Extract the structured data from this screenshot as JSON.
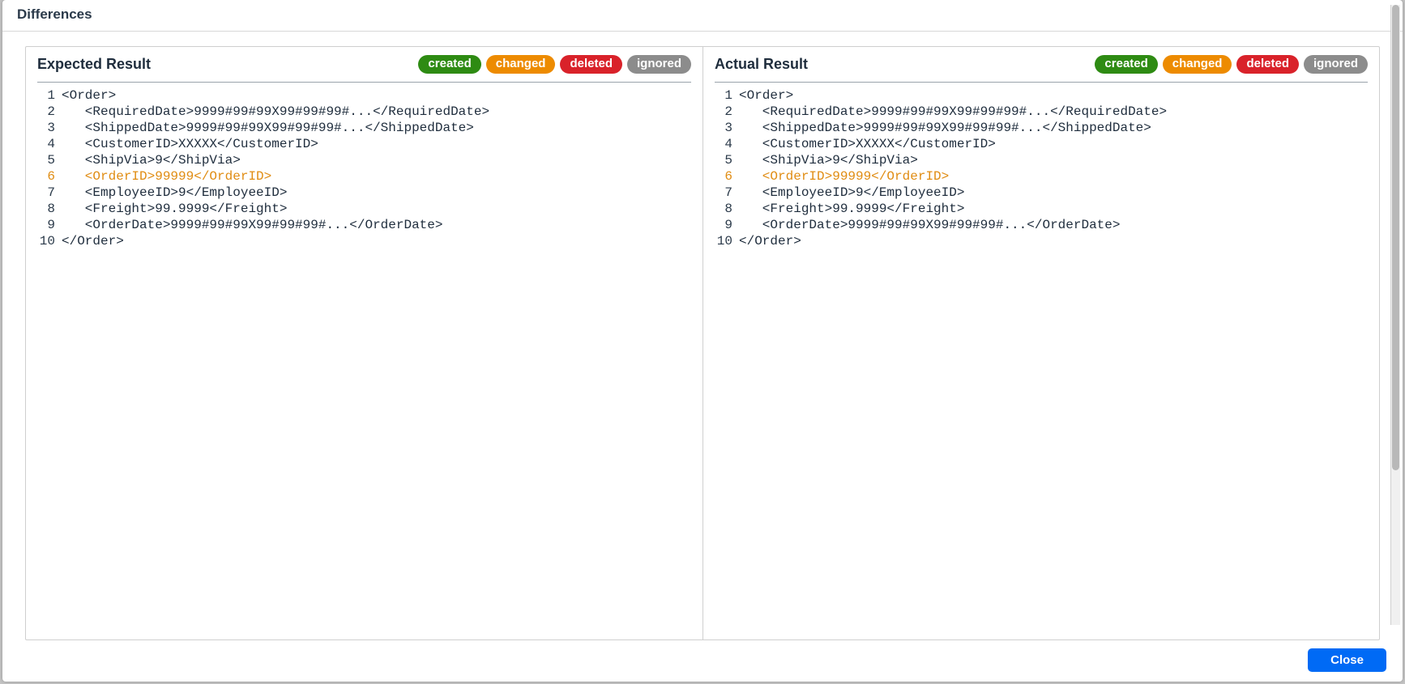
{
  "dialog": {
    "title": "Differences",
    "close_label": "Close"
  },
  "badges": {
    "created": "created",
    "changed": "changed",
    "deleted": "deleted",
    "ignored": "ignored"
  },
  "panes": [
    {
      "title": "Expected Result",
      "lines": [
        {
          "n": 1,
          "indent": 0,
          "text": "<Order>",
          "state": ""
        },
        {
          "n": 2,
          "indent": 1,
          "text": "<RequiredDate>9999#99#99X99#99#99#...</RequiredDate>",
          "state": ""
        },
        {
          "n": 3,
          "indent": 1,
          "text": "<ShippedDate>9999#99#99X99#99#99#...</ShippedDate>",
          "state": ""
        },
        {
          "n": 4,
          "indent": 1,
          "text": "<CustomerID>XXXXX</CustomerID>",
          "state": ""
        },
        {
          "n": 5,
          "indent": 1,
          "text": "<ShipVia>9</ShipVia>",
          "state": ""
        },
        {
          "n": 6,
          "indent": 1,
          "text": "<OrderID>99999</OrderID>",
          "state": "changed"
        },
        {
          "n": 7,
          "indent": 1,
          "text": "<EmployeeID>9</EmployeeID>",
          "state": ""
        },
        {
          "n": 8,
          "indent": 1,
          "text": "<Freight>99.9999</Freight>",
          "state": ""
        },
        {
          "n": 9,
          "indent": 1,
          "text": "<OrderDate>9999#99#99X99#99#99#...</OrderDate>",
          "state": ""
        },
        {
          "n": 10,
          "indent": 0,
          "text": "</Order>",
          "state": ""
        }
      ]
    },
    {
      "title": "Actual Result",
      "lines": [
        {
          "n": 1,
          "indent": 0,
          "text": "<Order>",
          "state": ""
        },
        {
          "n": 2,
          "indent": 1,
          "text": "<RequiredDate>9999#99#99X99#99#99#...</RequiredDate>",
          "state": ""
        },
        {
          "n": 3,
          "indent": 1,
          "text": "<ShippedDate>9999#99#99X99#99#99#...</ShippedDate>",
          "state": ""
        },
        {
          "n": 4,
          "indent": 1,
          "text": "<CustomerID>XXXXX</CustomerID>",
          "state": ""
        },
        {
          "n": 5,
          "indent": 1,
          "text": "<ShipVia>9</ShipVia>",
          "state": ""
        },
        {
          "n": 6,
          "indent": 1,
          "text": "<OrderID>99999</OrderID>",
          "state": "changed"
        },
        {
          "n": 7,
          "indent": 1,
          "text": "<EmployeeID>9</EmployeeID>",
          "state": ""
        },
        {
          "n": 8,
          "indent": 1,
          "text": "<Freight>99.9999</Freight>",
          "state": ""
        },
        {
          "n": 9,
          "indent": 1,
          "text": "<OrderDate>9999#99#99X99#99#99#...</OrderDate>",
          "state": ""
        },
        {
          "n": 10,
          "indent": 0,
          "text": "</Order>",
          "state": ""
        }
      ]
    }
  ]
}
